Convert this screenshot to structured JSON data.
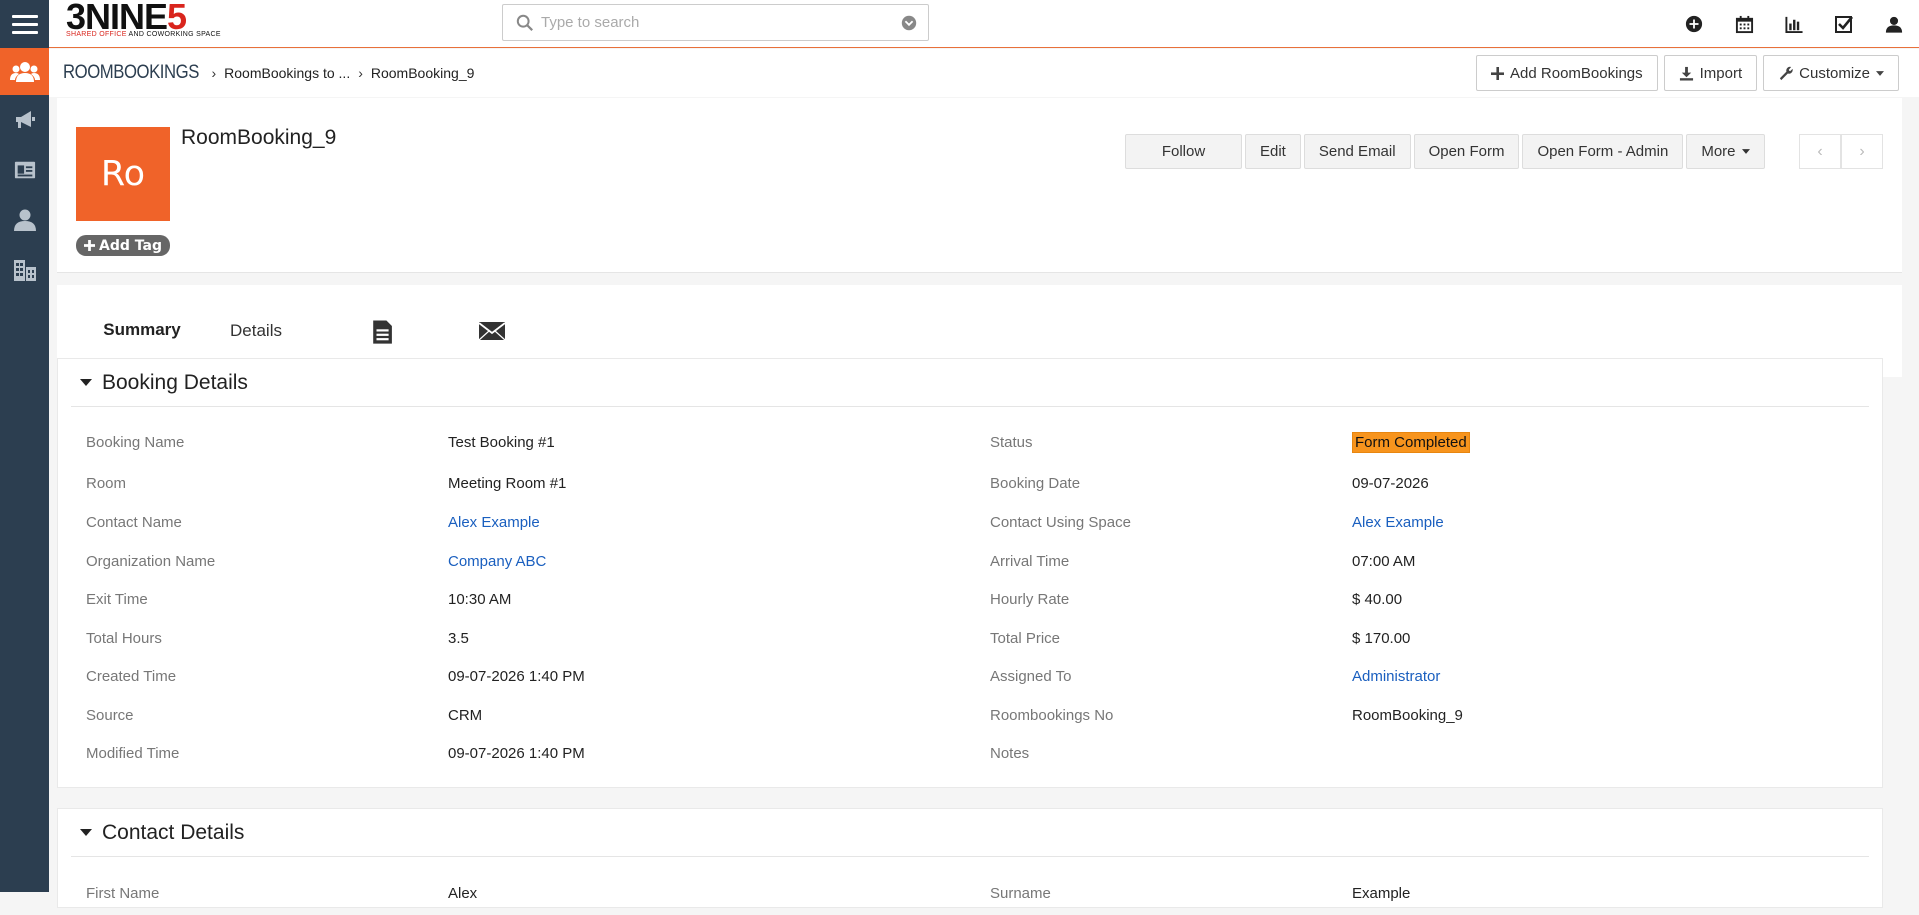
{
  "brand": {
    "logo_main_a": "3NINE",
    "logo_main_b": "5",
    "logo_sub_a": "SHARED OFFICE",
    "logo_sub_b": " AND COWORKING SPACE"
  },
  "search": {
    "placeholder": "Type to search"
  },
  "breadcrumb": {
    "module": "RoomBookings",
    "items": [
      "RoomBookings to ...",
      "RoomBooking_9"
    ]
  },
  "header_actions": {
    "add": "Add RoomBookings",
    "import": "Import",
    "customize": "Customize"
  },
  "record": {
    "avatar_initials": "Ro",
    "title": "RoomBooking_9",
    "add_tag": "Add Tag",
    "actions": [
      "Follow",
      "Edit",
      "Send Email",
      "Open Form",
      "Open Form - Admin",
      "More"
    ]
  },
  "tabs": [
    "Summary",
    "Details"
  ],
  "booking_details": {
    "title": "Booking Details",
    "left": [
      {
        "label": "Booking Name",
        "value": "Test Booking #1"
      },
      {
        "label": "Room",
        "value": "Meeting Room #1"
      },
      {
        "label": "Contact Name",
        "value": "Alex Example"
      },
      {
        "label": "Organization Name",
        "value": "Company ABC"
      },
      {
        "label": "Exit Time",
        "value": "10:30 AM"
      },
      {
        "label": "Total Hours",
        "value": "3.5"
      },
      {
        "label": "Created Time",
        "value": "09-07-2026 1:40 PM"
      },
      {
        "label": "Source",
        "value": "CRM"
      },
      {
        "label": "Modified Time",
        "value": "09-07-2026 1:40 PM"
      }
    ],
    "right": [
      {
        "label": "Status",
        "value": "Form Completed"
      },
      {
        "label": "Booking Date",
        "value": "09-07-2026"
      },
      {
        "label": "Contact Using Space",
        "value": "Alex Example"
      },
      {
        "label": "Arrival Time",
        "value": "07:00 AM"
      },
      {
        "label": "Hourly Rate",
        "value": "$ 40.00"
      },
      {
        "label": "Total Price",
        "value": "$ 170.00"
      },
      {
        "label": "Assigned To",
        "value": "Administrator"
      },
      {
        "label": "Roombookings No",
        "value": "RoomBooking_9"
      },
      {
        "label": "Notes",
        "value": ""
      }
    ]
  },
  "contact_details": {
    "title": "Contact Details",
    "left": [
      {
        "label": "First Name",
        "value": "Alex"
      }
    ],
    "right": [
      {
        "label": "Surname",
        "value": "Example"
      }
    ]
  },
  "colors": {
    "sidebar": "#2c3e50",
    "accent": "#f06329",
    "link": "#1a5fbf",
    "status_badge": "#f7941d"
  }
}
